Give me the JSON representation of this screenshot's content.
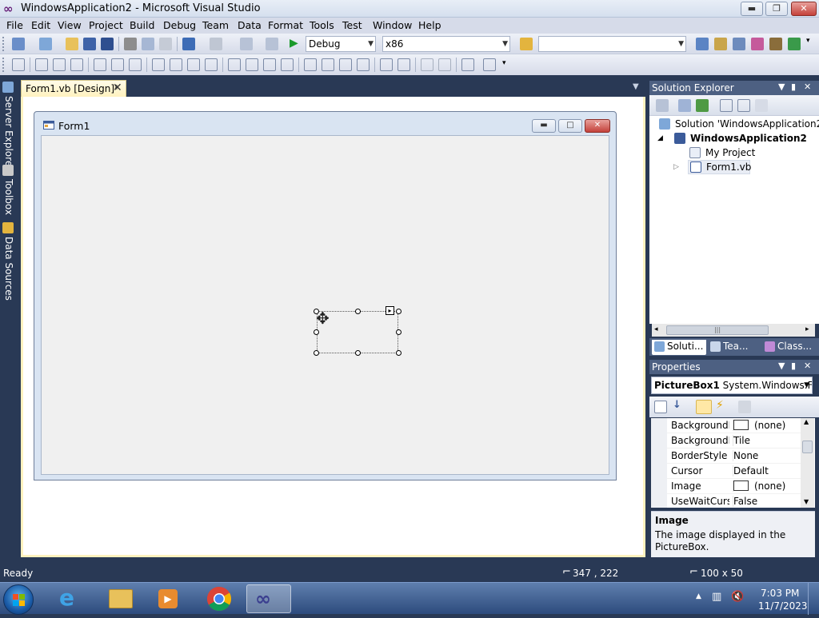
{
  "window": {
    "title": "WindowsApplication2 - Microsoft Visual Studio",
    "min_label": "▬",
    "max_label": "❐",
    "close_label": "✕"
  },
  "menu": {
    "items": [
      "File",
      "Edit",
      "View",
      "Project",
      "Build",
      "Debug",
      "Team",
      "Data",
      "Format",
      "Tools",
      "Test",
      "Window",
      "Help"
    ]
  },
  "toolbar": {
    "config": "Debug",
    "platform": "x86",
    "search_value": ""
  },
  "left_tabs": {
    "server_explorer": "Server Explorer",
    "toolbox": "Toolbox",
    "data_sources": "Data Sources"
  },
  "document": {
    "tab_label": "Form1.vb [Design]*",
    "form_title": "Form1"
  },
  "solution_explorer": {
    "title": "Solution Explorer",
    "solution": "Solution 'WindowsApplication2'",
    "project": "WindowsApplication2",
    "my_project": "My Project",
    "form_file": "Form1.vb",
    "tabs": [
      "Soluti...",
      "Tea...",
      "Class..."
    ]
  },
  "properties": {
    "title": "Properties",
    "object": "PictureBox1",
    "object_type": "System.Windows.For",
    "rows": [
      {
        "name": "BackgroundIr",
        "value": "(none)"
      },
      {
        "name": "BackgroundIr",
        "value": "Tile"
      },
      {
        "name": "BorderStyle",
        "value": "None"
      },
      {
        "name": "Cursor",
        "value": "Default"
      },
      {
        "name": "Image",
        "value": "(none)"
      },
      {
        "name": "UseWaitCursc",
        "value": "False"
      }
    ],
    "desc_title": "Image",
    "desc_text": "The image displayed in the PictureBox."
  },
  "status": {
    "text": "Ready",
    "position": "347 , 222",
    "size": "100 x 50"
  },
  "taskbar": {
    "time": "7:03 PM",
    "date": "11/7/2023"
  },
  "colors": {
    "vs_dark_blue": "#293955",
    "panel_header": "#4d6082",
    "tab_gold": "#fff2bf"
  }
}
